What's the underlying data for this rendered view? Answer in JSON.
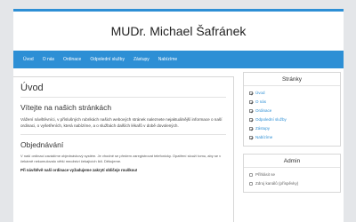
{
  "header": {
    "title": "MUDr. Michael Šafránek"
  },
  "nav": {
    "items": [
      {
        "label": "Úvod"
      },
      {
        "label": "O nás"
      },
      {
        "label": "Ordinace"
      },
      {
        "label": "Odpolední služby"
      },
      {
        "label": "Zástupy"
      },
      {
        "label": "Nabízíme"
      }
    ]
  },
  "main": {
    "title": "Úvod",
    "welcome": "Vítejte na našich stránkách",
    "intro": "Vážení návštěvníci, v příslušných rubrikách našich webových stránek naleznete nejaktuálnější informace o naší ordinaci, o vyšetřeních, která nabízíme, a o službách dalších lékařů v době dovolených.",
    "orders_title": "Objednávání",
    "orders_text": "V naší ordinaci zavádíme objednávkový systém. Je vhodné se předem zaregistrovat telefonicky. Opatření slouží tomu, aby se v čekárně nekumulovalo větší množství čekajících lidí. Děkujeme.",
    "warning": "Při návštěvě naší ordinace vyžadujeme zakrytí obličeje rouškou!"
  },
  "sidebar": {
    "pages_title": "Stránky",
    "pages": [
      {
        "label": "Úvod"
      },
      {
        "label": "O nás"
      },
      {
        "label": "Ordinace"
      },
      {
        "label": "Odpolední služby"
      },
      {
        "label": "Zástupy"
      },
      {
        "label": "Nabízíme"
      }
    ],
    "admin_title": "Admin",
    "admin": [
      {
        "label": "Přihlásit se"
      },
      {
        "label": "Zdroj kanálů (příspěvky)"
      }
    ]
  },
  "colors": {
    "accent": "#2d8fd5",
    "background": "#e4e6e9"
  }
}
